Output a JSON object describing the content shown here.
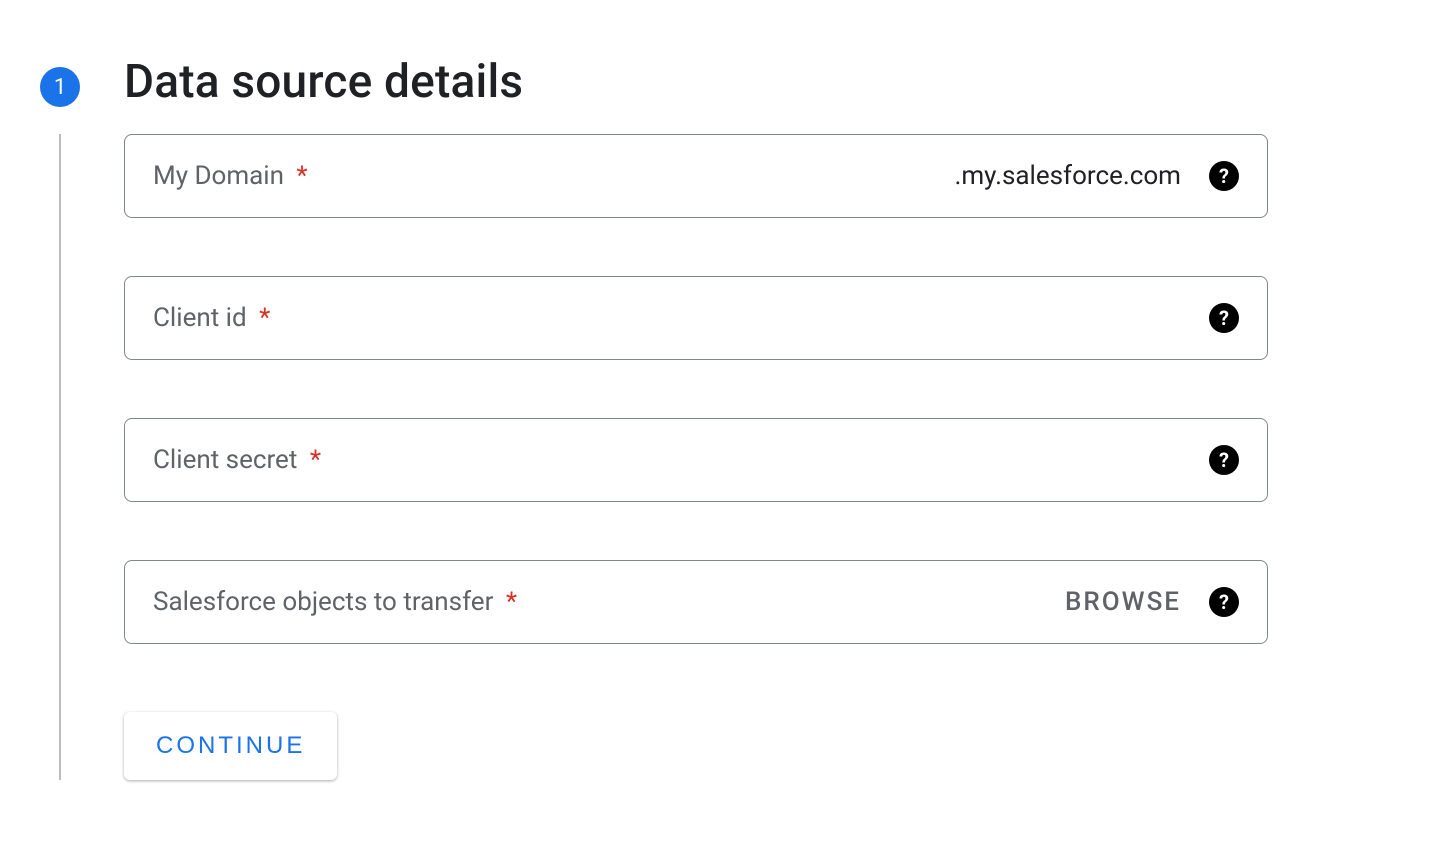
{
  "step": {
    "number": "1",
    "title": "Data source details"
  },
  "fields": {
    "myDomain": {
      "label": "My Domain",
      "required": "*",
      "suffix": ".my.salesforce.com",
      "help": "?"
    },
    "clientId": {
      "label": "Client id",
      "required": "*",
      "help": "?"
    },
    "clientSecret": {
      "label": "Client secret",
      "required": "*",
      "help": "?"
    },
    "objects": {
      "label": "Salesforce objects to transfer",
      "required": "*",
      "action": "BROWSE",
      "help": "?"
    }
  },
  "buttons": {
    "continue": "CONTINUE"
  }
}
